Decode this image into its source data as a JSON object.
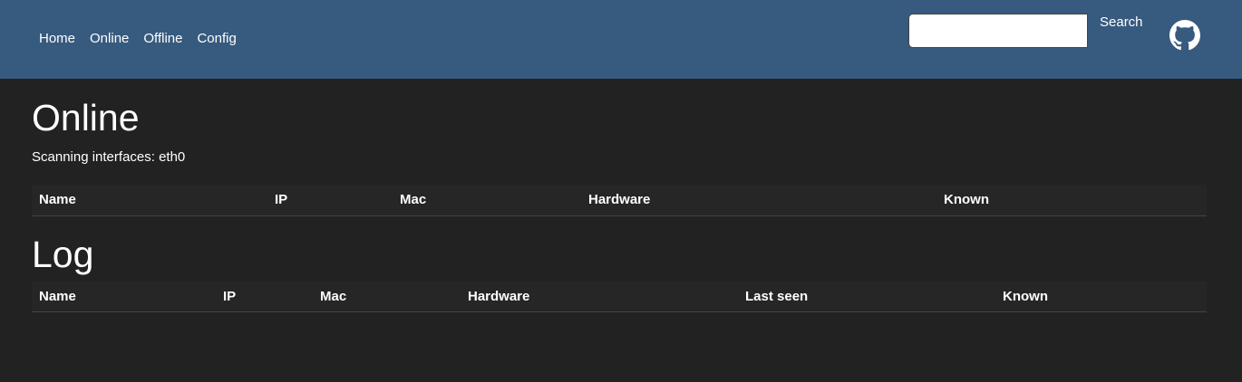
{
  "nav": {
    "links": [
      "Home",
      "Online",
      "Offline",
      "Config"
    ],
    "search_button": "Search",
    "search_placeholder": ""
  },
  "online": {
    "title": "Online",
    "status": "Scanning interfaces: eth0",
    "columns": [
      "Name",
      "IP",
      "Mac",
      "Hardware",
      "Known"
    ]
  },
  "log": {
    "title": "Log",
    "columns": [
      "Name",
      "IP",
      "Mac",
      "Hardware",
      "Last seen",
      "Known"
    ]
  },
  "colors": {
    "navbar": "#375a7f",
    "background": "#222222",
    "header_row": "#262626"
  },
  "icons": [
    "github-icon"
  ]
}
